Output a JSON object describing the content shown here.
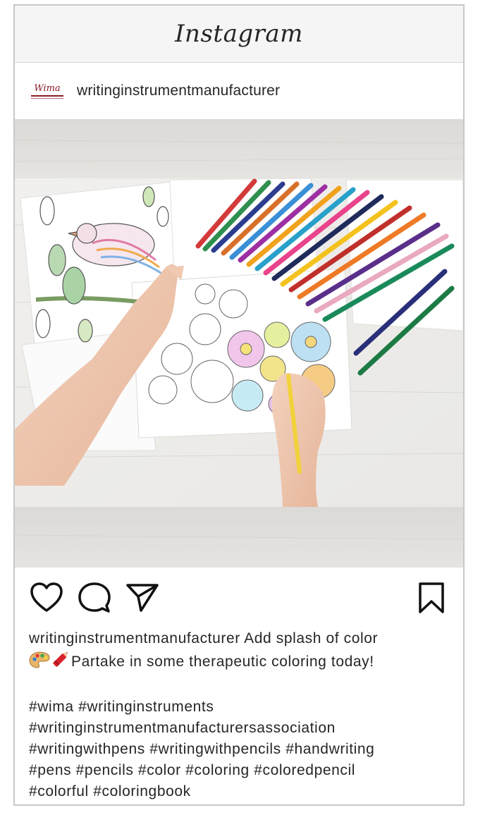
{
  "app": {
    "title": "Instagram"
  },
  "post": {
    "username": "writinginstrumentmanufacturer",
    "avatar_text": "Wima",
    "caption_user": "writinginstrumentmanufacturer",
    "caption_text": "Add splash of color",
    "caption_line2": "Partake in some therapeutic coloring today!",
    "hashtags": "#wima #writinginstruments\n#writinginstrumentmanufacturersassociation\n#writingwithpens #writingwithpencils #handwriting\n#pens #pencils #color #coloring #coloredpencil\n#colorful #coloringbook"
  },
  "icons": {
    "like": "heart-icon",
    "comment": "comment-bubble-icon",
    "share": "paper-plane-icon",
    "save": "bookmark-icon",
    "emoji1": "artist-palette-icon",
    "emoji2": "crayon-icon"
  },
  "colors": {
    "text": "#262626",
    "header_bg": "#f5f5f5",
    "border": "#c8c8c8",
    "brand_red": "#8a1c24"
  }
}
